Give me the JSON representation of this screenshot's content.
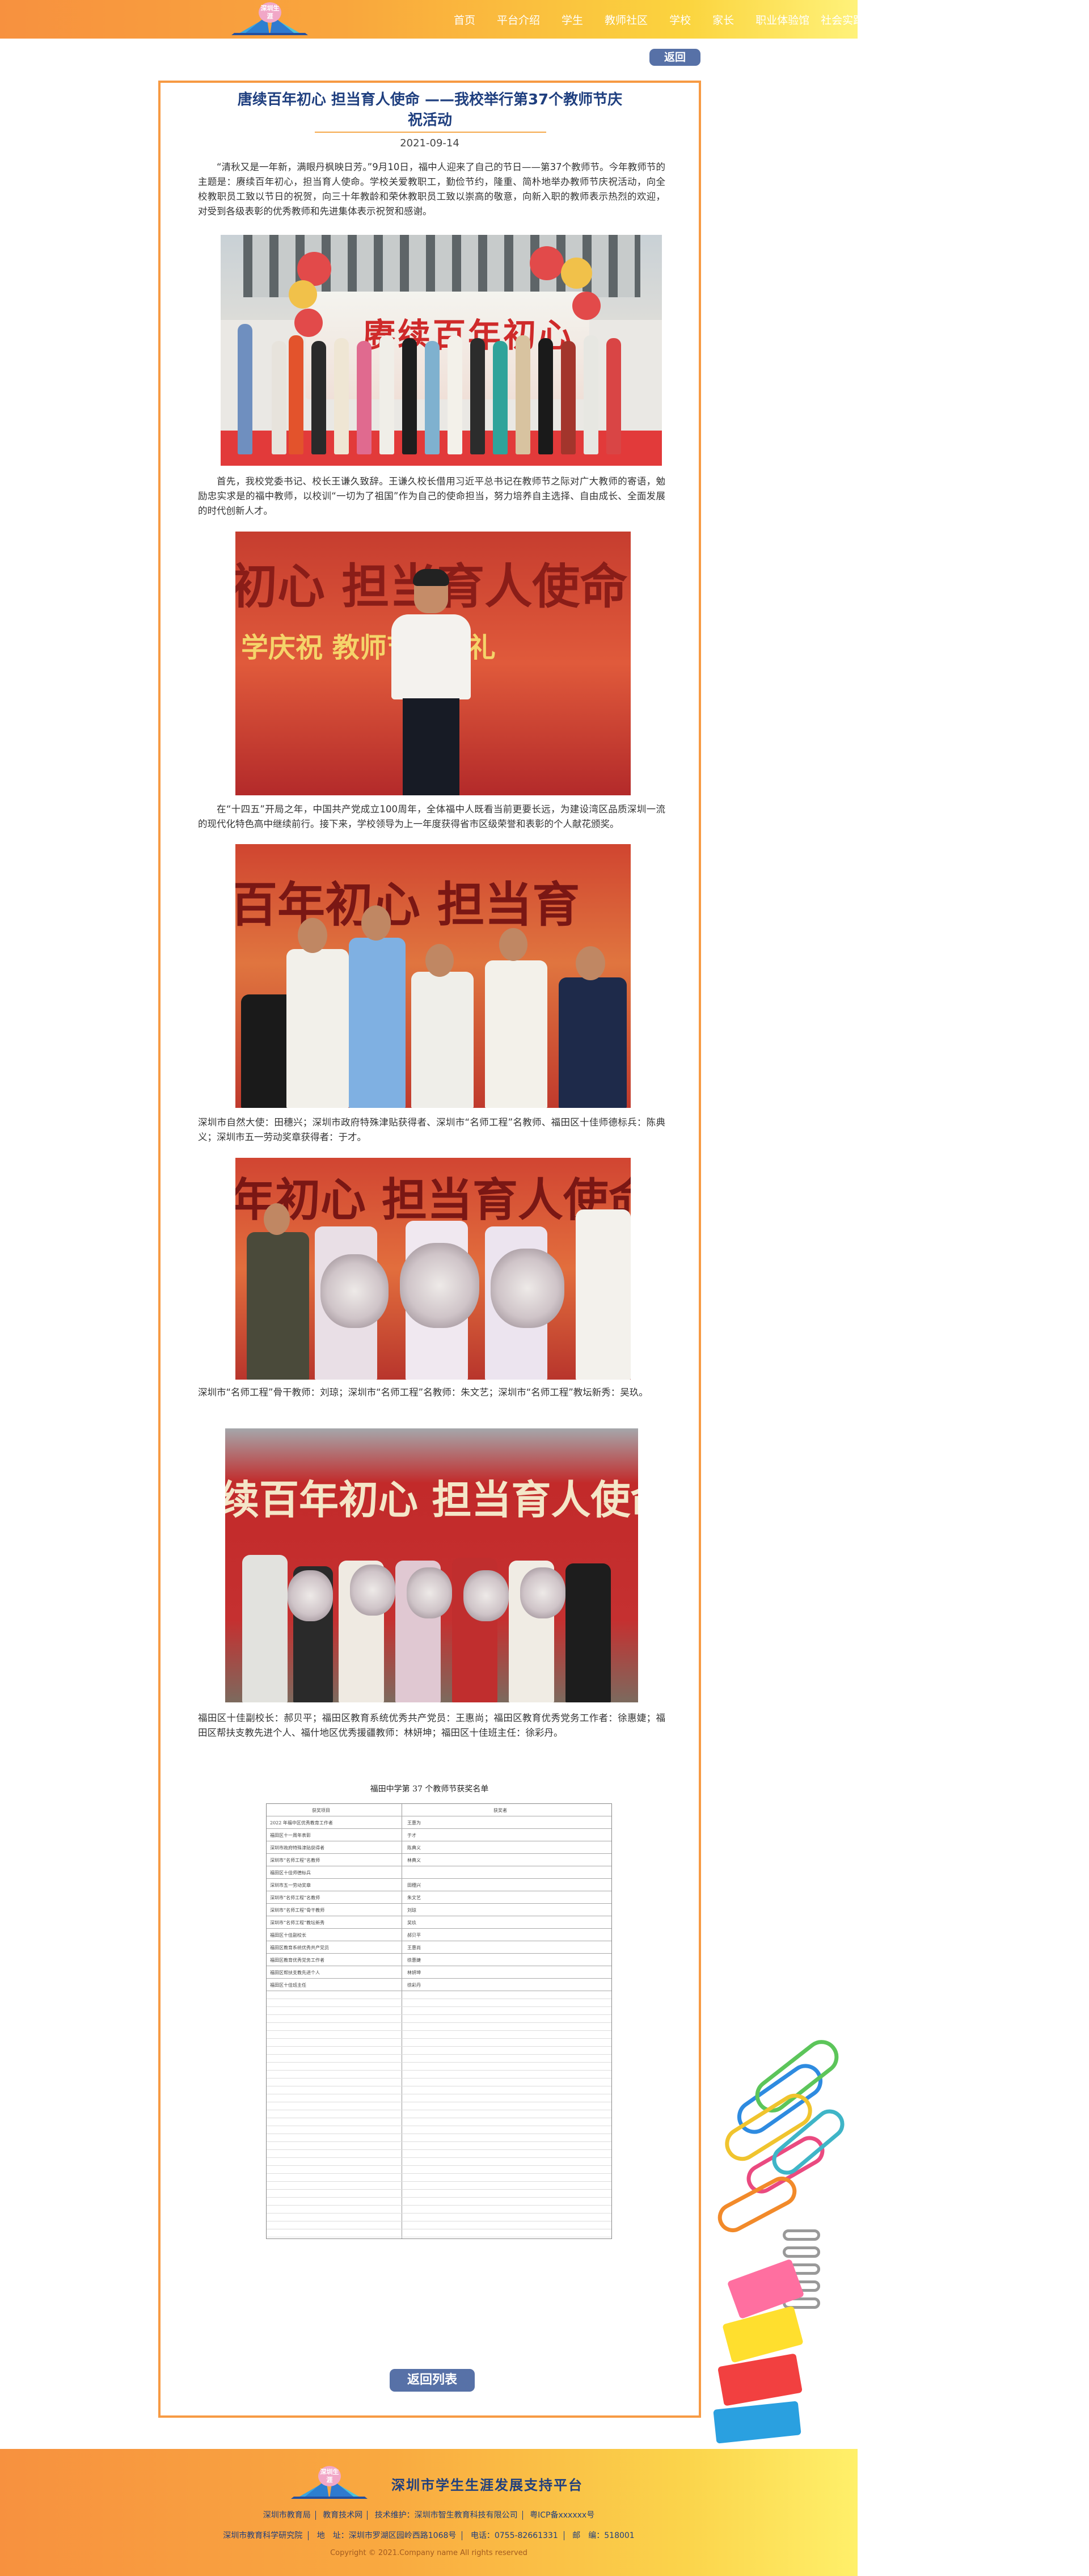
{
  "header": {
    "logo_text": "深圳生涯",
    "nav": [
      "首页",
      "平台介绍",
      "学生",
      "教师社区",
      "学校",
      "家长",
      "职业体验馆",
      "社会实践"
    ]
  },
  "article": {
    "back_top": "返回",
    "title_line1": "唐续百年初心 担当育人使命 ——我校举行第37个教师节庆",
    "title_line2": "祝活动",
    "date": "2021-09-14",
    "paragraphs": [
      "“清秋又是一年新，满眼丹枫映日芳。”9月10日，福中人迎来了自己的节日——第37个教师节。今年教师节的主题是：赓续百年初心，担当育人使命。学校关爱教职工，勤俭节约，隆重、简朴地举办教师节庆祝活动，向全校教职员工致以节日的祝贺，向三十年教龄和荣休教职员工致以崇高的敬意，向新入职的教师表示热烈的欢迎，对受到各级表彰的优秀教师和先进集体表示祝贺和感谢。",
      "首先，我校党委书记、校长王谦久致辞。王谦久校长借用习近平总书记在教师节之际对广大教师的寄语，勉励忠实求是的福中教师，以校训“一切为了祖国”作为自己的使命担当，努力培养自主选择、自由成长、全面发展的时代创新人才。",
      "在“十四五”开局之年，中国共产党成立100周年，全体福中人既看当前更要长远，为建设湾区品质深圳一流的现代化特色高中继续前行。接下来，学校领导为上一年度获得省市区级荣誉和表彰的个人献花颁奖。",
      "深圳市自然大使：田穗兴；深圳市政府特殊津贴获得者、深圳市“名师工程”名教师、福田区十佳师德标兵：陈典义；深圳市五一劳动奖章获得者：于才。",
      "深圳市“名师工程”骨干教师：刘琼；深圳市“名师工程”名教师：朱文艺；深圳市“名师工程”教坛新秀：吴玖。",
      "福田区十佳副校长：郝贝平；福田区教育系统优秀共产党员：王惠尚；福田区教育优秀党务工作者：徐惠婕；福田区帮扶支教先进个人、福什地区优秀援疆教师：林妍坤；福田区十佳班主任：徐彩丹。"
    ],
    "photo1_banner": "赓续百年初心",
    "photo2_banner_line1": "初心  担当育人使命",
    "photo2_banner_line2": "学庆祝     教师节颁奖礼",
    "photo3_banner": "百年初心  担当育",
    "photo4_banner": "年初心  担当育人使命",
    "photo5_banner": "续百年初心 担当育人使命",
    "doc_title": "福田中学第 37 个教师节获奖名单",
    "doc_header": [
      "获奖项目",
      "获奖者"
    ],
    "doc_rows": [
      [
        "2022 年福中区优秀教育工作者",
        "王惠为"
      ],
      [
        "福田区十一周年表彰",
        "于才"
      ],
      [
        "深圳市政府特殊津贴获得者",
        "陈典义"
      ],
      [
        "深圳市“名师工程”名教师",
        "林典义"
      ],
      [
        "福田区十佳师德标兵",
        ""
      ],
      [
        "深圳市五一劳动奖章",
        "田穗兴"
      ],
      [
        "深圳市“名师工程”名教师",
        "朱文艺"
      ],
      [
        "深圳市“名师工程”骨干教师",
        "刘琼"
      ],
      [
        "深圳市“名师工程”教坛新秀",
        "吴玖"
      ],
      [
        "福田区十佳副校长",
        "郝贝平"
      ],
      [
        "福田区教育系统优秀共产党员",
        "王惠尚"
      ],
      [
        "福田区教育优秀党务工作者",
        "徐惠婕"
      ],
      [
        "福田区帮扶支教先进个人",
        "林妍坤"
      ],
      [
        "福田区十佳班主任",
        "徐彩丹"
      ]
    ],
    "back_list": "返回列表"
  },
  "footer": {
    "logo_text": "深圳生涯",
    "title": "深圳市学生生涯发展支持平台",
    "links": [
      "深圳市教育局",
      "教育技术网",
      "技术维护：深圳市智生教育科技有限公司",
      "粤ICP备xxxxxx号"
    ],
    "address": [
      "深圳市教育科学研究院",
      "地　址：深圳市罗湖区园岭西路1068号",
      "电话：0755-82661331",
      "邮　编：518001"
    ],
    "copyright": "Copyright © 2021.Company name All rights reserved"
  },
  "colors": {
    "header_gradient_start": "#f7913f",
    "header_gradient_end": "#fff27a",
    "title_blue": "#1f3f7f",
    "button_blue": "#5771a7",
    "article_border": "#f79a43"
  }
}
